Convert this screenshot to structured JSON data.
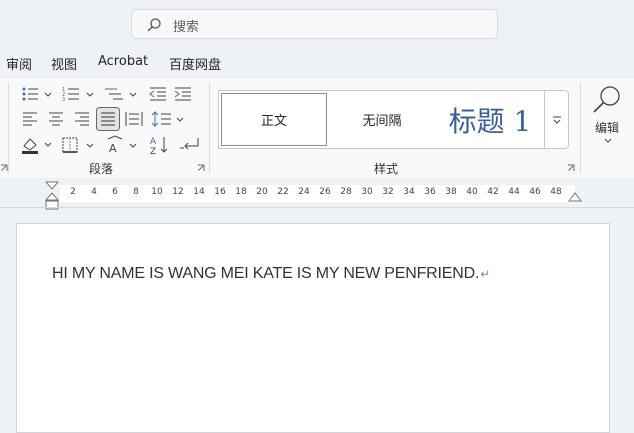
{
  "search": {
    "placeholder": "搜索"
  },
  "menu_tabs": [
    "审阅",
    "视图",
    "Acrobat",
    "百度网盘"
  ],
  "ribbon": {
    "paragraph_label": "段落",
    "styles_label": "样式",
    "styles": [
      "正文",
      "无间隔",
      "标题 1"
    ],
    "edit_label": "编辑"
  },
  "ruler": {
    "numbers": [
      "2",
      "4",
      "6",
      "8",
      "10",
      "12",
      "14",
      "16",
      "18",
      "20",
      "22",
      "24",
      "26",
      "28",
      "30",
      "32",
      "34",
      "36",
      "38",
      "40",
      "42",
      "44",
      "46",
      "48"
    ]
  },
  "document": {
    "text": "HI MY NAME IS WANG MEI KATE IS MY NEW PENFRIEND.",
    "para_mark": "↵"
  }
}
